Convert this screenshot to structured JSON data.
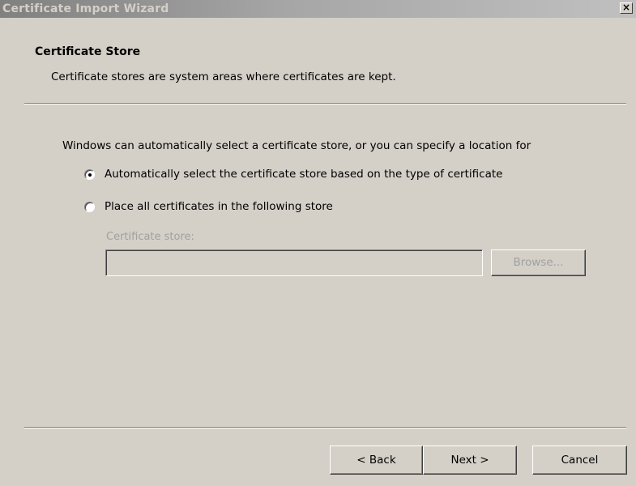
{
  "window": {
    "title": "Certificate Import Wizard",
    "close_label": "×"
  },
  "header": {
    "title": "Certificate Store",
    "subtitle": "Certificate stores are system areas where certificates are kept."
  },
  "body": {
    "intro": "Windows can automatically select a certificate store, or you can specify a location for",
    "options": [
      {
        "label": "Automatically select the certificate store based on the type of certificate",
        "selected": true
      },
      {
        "label": "Place all certificates in the following store",
        "selected": false
      }
    ],
    "store": {
      "label": "Certificate store:",
      "value": "",
      "enabled": false,
      "browse_label": "Browse..."
    }
  },
  "footer": {
    "back_label": "< Back",
    "next_label": "Next >",
    "cancel_label": "Cancel"
  },
  "colors": {
    "dialog_bg": "#d4d0c8",
    "title_gradient_start": "#808080",
    "title_gradient_end": "#c0c0c0",
    "disabled_text": "#a0a0a0"
  }
}
